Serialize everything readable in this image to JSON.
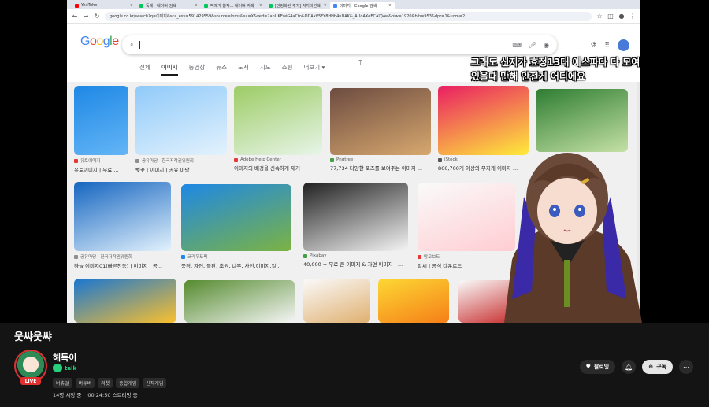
{
  "browser": {
    "tabs": [
      {
        "label": "YouTube",
        "color": "#ff0000",
        "active": false
      },
      {
        "label": "독제 - 네이버 검색",
        "color": "#03c75a",
        "active": false
      },
      {
        "label": "멕제가 합작... 네이버 카페",
        "color": "#03c75a",
        "active": false
      },
      {
        "label": "[안정화된 주가] 저지의선택",
        "color": "#03c75a",
        "active": false
      },
      {
        "label": "이미지 - Google 검색",
        "color": "#4285f4",
        "active": true
      }
    ],
    "url": "google.co.kr/search?q=이미지&sca_esv=591429559&source=lnms&sa=X&ved=2ahUKEwiG4aCfo&DDAxV5FY8HHb4nDAK&_AUoAXoECAIQAw&biw=1920&bih=953&dpr=1&udm=2"
  },
  "google": {
    "logo": "Google",
    "search_value": "",
    "tabs": [
      "전체",
      "이미지",
      "동영상",
      "뉴스",
      "도서",
      "지도",
      "쇼핑",
      "더보기 ▾"
    ]
  },
  "results": [
    {
      "source": "유토이미지",
      "caption": "유토이미지 | 무료 ...",
      "src_color": "#e53935",
      "palette": [
        "#1e88e5",
        "#64b5f6"
      ],
      "kind": "pom"
    },
    {
      "source": "공유마당 · 한국저작권위원회",
      "caption": "벚꽃 | 이미지 | 공유 마당",
      "src_color": "#8e8e8e",
      "palette": [
        "#90caf9",
        "#e3f2fd"
      ],
      "kind": "blossom"
    },
    {
      "source": "Adobe Help Center",
      "caption": "이미지의 배경을 신속하게 제거",
      "src_color": "#e53935",
      "palette": [
        "#9ccc65",
        "#e8f5e9"
      ],
      "kind": "puppy"
    },
    {
      "source": "Pngtree",
      "caption": "77,734 다양한 포즈를 보여주는 이미지 ...",
      "src_color": "#43a047",
      "palette": [
        "#6d4c41",
        "#d7a86e"
      ],
      "kind": "dogs"
    },
    {
      "source": "iStock",
      "caption": "866,700개 이상의 무지개 이미지 ...",
      "src_color": "#555555",
      "palette": [
        "#e91e63",
        "#ffeb3b"
      ],
      "kind": "flower"
    },
    {
      "source": "",
      "caption": "",
      "src_color": "#555555",
      "palette": [
        "#2e7d32",
        "#c5e1a5"
      ],
      "kind": "trees"
    },
    {
      "source": "공유마당 · 한국저작권위원회",
      "caption": "하늘 이미지01(빠른천둥) | 이미지 | 공...",
      "src_color": "#8e8e8e",
      "palette": [
        "#1565c0",
        "#e3f2fd"
      ],
      "kind": "sky"
    },
    {
      "source": "크라우도픽",
      "caption": "풍경, 자연, 들판, 초원, 나무, 사진,이미지,일...",
      "src_color": "#1e88e5",
      "palette": [
        "#1e88e5",
        "#7cb342"
      ],
      "kind": "field"
    },
    {
      "source": "Pixabay",
      "caption": "40,000 + 무료 큰 이미지 & 자연 이미지 - ...",
      "src_color": "#43a047",
      "palette": [
        "#212121",
        "#f5f5f5"
      ],
      "kind": "wolf"
    },
    {
      "source": "망고보드",
      "caption": "알씨 | 공식 다운로드",
      "src_color": "#e53935",
      "palette": [
        "#fafafa",
        "#ffcdd2"
      ],
      "kind": "mascot"
    },
    {
      "source": "",
      "caption": "",
      "src_color": "#555555",
      "palette": [
        "#1976d2",
        "#fbc02d"
      ],
      "kind": "sunflower"
    },
    {
      "source": "",
      "caption": "",
      "src_color": "#555555",
      "palette": [
        "#558b2f",
        "#f5f5f5"
      ],
      "kind": "rabbit"
    },
    {
      "source": "",
      "caption": "",
      "src_color": "#555555",
      "palette": [
        "#fafafa",
        "#e0b070"
      ],
      "kind": "retriever"
    },
    {
      "source": "",
      "caption": "",
      "src_color": "#555555",
      "palette": [
        "#fdd835",
        "#f57f17"
      ],
      "kind": "ryan"
    },
    {
      "source": "",
      "caption": "",
      "src_color": "#555555",
      "palette": [
        "#fafafa",
        "#c62828"
      ],
      "kind": "person"
    }
  ],
  "overlay": {
    "subtitle": "그래도 신지가 효정13대 에스파다 다 모여있을때 만해 안전게 어디에요"
  },
  "stream": {
    "title": "웃쌰웃쌰",
    "channel_name": "해득이",
    "live_label": "LIVE",
    "talk_label": "talk",
    "tags": [
      "버츄얼",
      "버튜버",
      "저챗",
      "종합게임",
      "신작게임"
    ],
    "viewers": "14명 시청 중",
    "uptime": "00:24:50 스트리밍 중",
    "follow_label": "팔로잉",
    "subscribe_label": "구독"
  }
}
